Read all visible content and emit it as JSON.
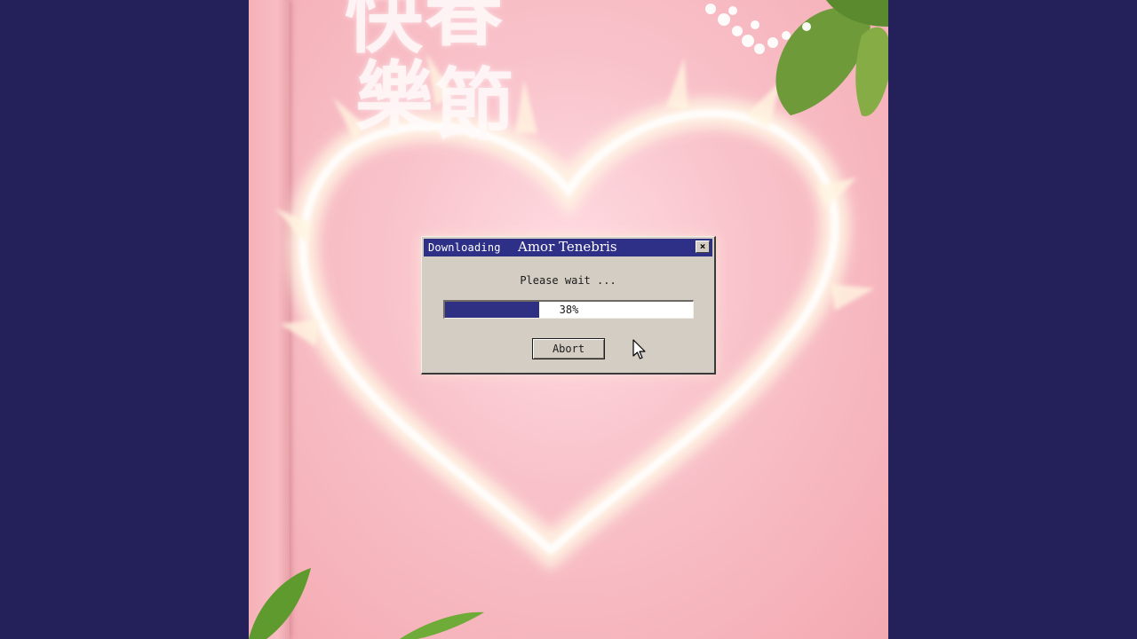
{
  "dialog": {
    "title_label": "Downloading",
    "title_name": "Amor Tenebris",
    "close_glyph": "×",
    "message": "Please wait ...",
    "progress_percent": 38,
    "progress_text": "38%",
    "abort_label": "Abort"
  },
  "artwork": {
    "cover_glyphs": [
      "快",
      "春",
      "樂",
      "節"
    ]
  },
  "colors": {
    "letterbox": "#24215a",
    "titlebar": "#2e2f86",
    "progress_fill": "#2f3083",
    "dialog_face": "#d4cdc3",
    "artwork_pink": "#f7b7bf"
  },
  "icons": {
    "close": "close-icon",
    "cursor": "mouse-pointer-icon"
  }
}
